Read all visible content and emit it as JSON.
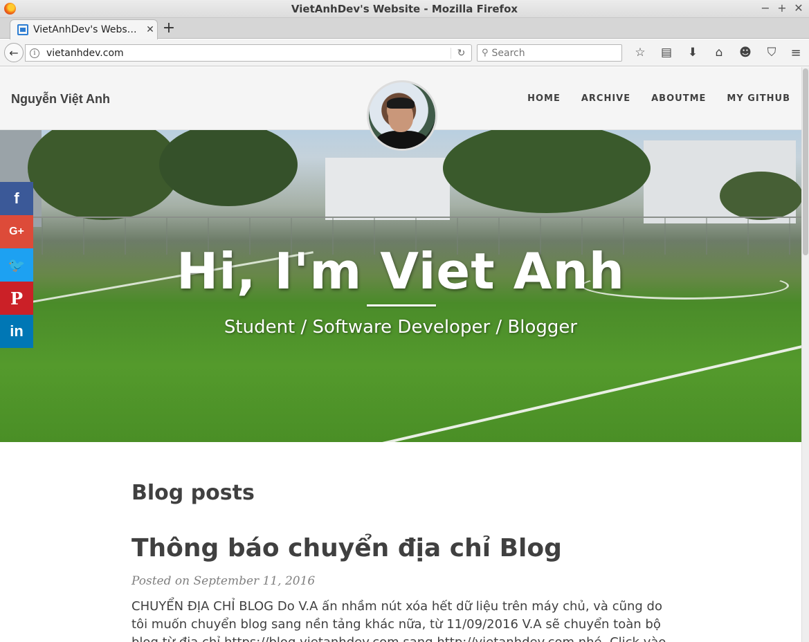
{
  "window": {
    "title": "VietAnhDev's Website - Mozilla Firefox",
    "controls": [
      "−",
      "+",
      "✕"
    ]
  },
  "tab": {
    "label": "VietAnhDev's Webs…",
    "close": "✕",
    "new_tab": "+"
  },
  "navbar": {
    "back": "←",
    "url": "vietanhdev.com",
    "info": "i",
    "reload": "↻",
    "search_placeholder": "Search",
    "search_icon": "search-icon",
    "toolbar_icons": [
      "☆",
      "▤",
      "⬇",
      "⌂",
      "☻",
      "⛉"
    ],
    "menu": "≡"
  },
  "site": {
    "brand": "Nguyễn Việt Anh",
    "nav": [
      "HOME",
      "ARCHIVE",
      "ABOUTME",
      "MY GITHUB"
    ]
  },
  "hero": {
    "title": "Hi, I'm Viet Anh",
    "subtitle": "Student / Software Developer / Blogger"
  },
  "share": {
    "facebook": "f",
    "googleplus": "G+",
    "twitter": "🐦",
    "pinterest": "P",
    "linkedin": "in"
  },
  "content": {
    "section_title": "Blog posts",
    "post": {
      "title": "Thông báo chuyển địa chỉ Blog",
      "meta": "Posted on September 11, 2016",
      "excerpt": "CHUYỂN ĐỊA CHỈ BLOG Do V.A ấn nhầm nút xóa hết dữ liệu trên máy chủ, và cũng do tôi muốn chuyển blog sang nền tảng khác nữa, từ 11/09/2016 V.A sẽ chuyển toàn bộ blog từ địa chỉ https://blog.vietanhdev.com sang http://vietanhdev.com nhé. Click vào đây để chuyển"
    }
  }
}
